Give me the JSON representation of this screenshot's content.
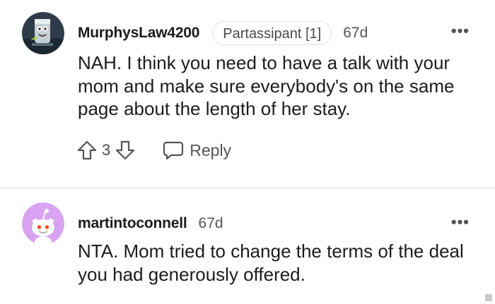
{
  "comments": [
    {
      "username": "MurphysLaw4200",
      "flair": "Partassipant [1]",
      "time": "67d",
      "text": "NAH. I think you need to have a talk with your mom and make sure everybody's on the same page about the length of her stay.",
      "score": "3",
      "reply_label": "Reply",
      "more_label": "•••"
    },
    {
      "username": "martintoconnell",
      "time": "67d",
      "text": "NTA. Mom tried to change the terms of the deal you had generously offered.",
      "more_label": "•••"
    }
  ],
  "icons": {
    "upvote": "arrow-up-outline",
    "downvote": "arrow-down-outline",
    "reply": "speech-bubble",
    "more": "horizontal-ellipsis"
  },
  "colors": {
    "avatar1_bg": "#2f3b48",
    "avatar2_bg": "#d9a3f2",
    "snoo": "#ffffff"
  }
}
